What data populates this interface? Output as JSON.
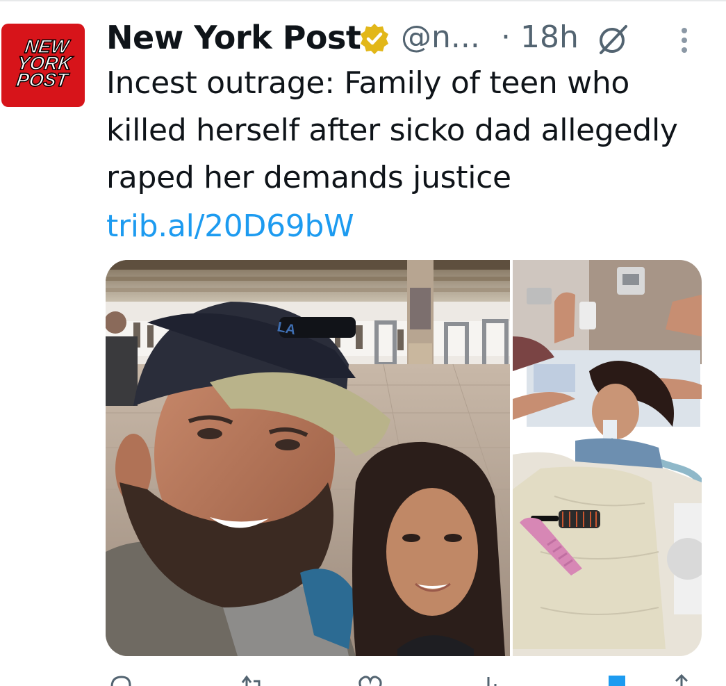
{
  "author": {
    "display_name": "New York Post",
    "handle": "@n...",
    "avatar_lines": [
      "NEW",
      "YORK",
      "POST"
    ],
    "verified": true
  },
  "meta": {
    "separator": "·",
    "timestamp": "18h"
  },
  "tweet": {
    "text": "Incest outrage: Family of teen who killed herself after sicko dad allegedly raped her demands justice",
    "link": "trib.al/20D69bW"
  },
  "media": [
    {
      "icon": "photo-selfie"
    },
    {
      "icon": "photo-hospital"
    }
  ],
  "actions": [
    {
      "icon": "reply-icon"
    },
    {
      "icon": "retweet-icon"
    },
    {
      "icon": "like-icon"
    },
    {
      "icon": "views-icon"
    },
    {
      "icon": "bookmark-icon"
    },
    {
      "icon": "share-icon"
    }
  ],
  "colors": {
    "brand_red": "#d7141a",
    "link_blue": "#1d9bf0",
    "verified_gold": "#e2b719",
    "secondary_text": "#536471"
  }
}
